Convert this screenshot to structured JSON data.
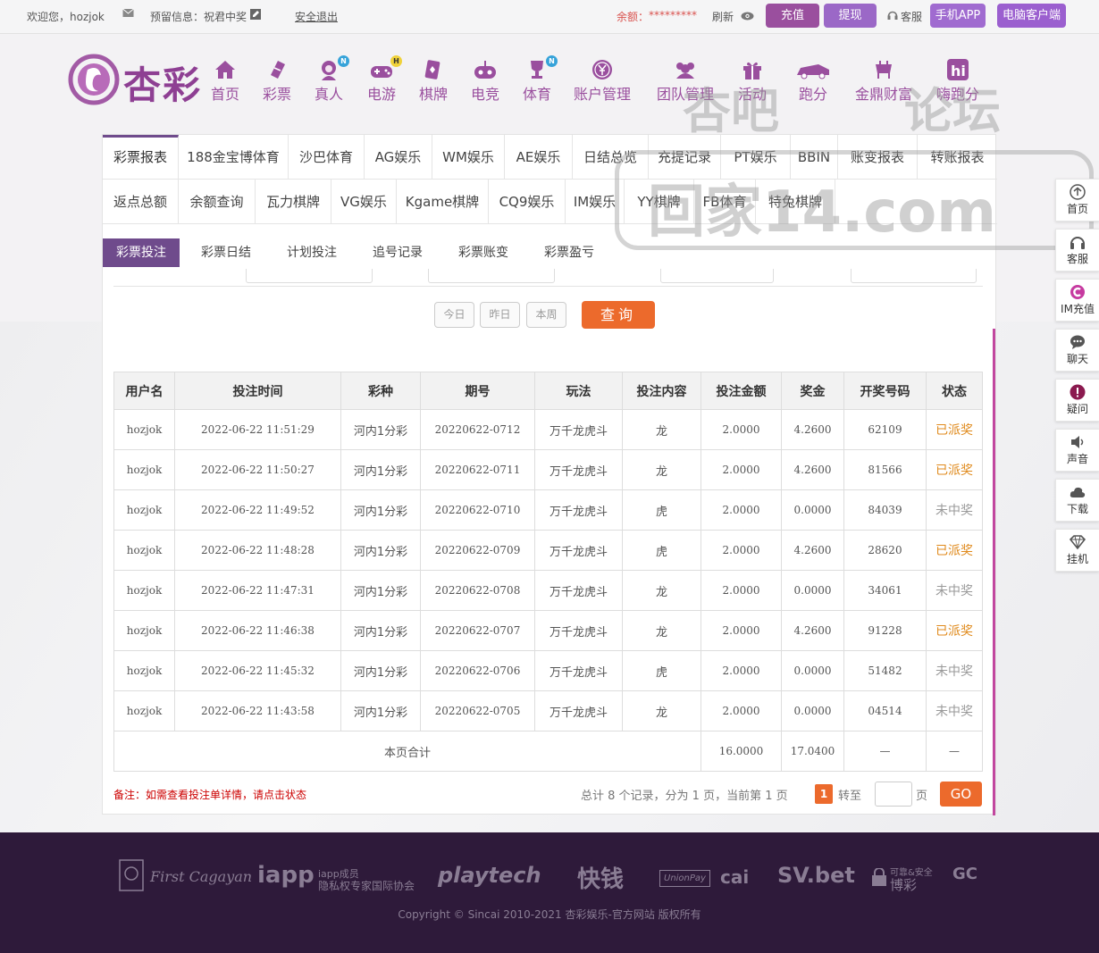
{
  "topbar": {
    "welcome": "欢迎您，hozjok",
    "reserved_info": "预留信息：祝君中奖",
    "logout": "安全退出",
    "balance_label": "余额：",
    "balance_value": "*********",
    "refresh": "刷新",
    "charge": "充值",
    "withdraw": "提现",
    "service": "客服",
    "mobile_app": "手机APP",
    "pc_client": "电脑客户端"
  },
  "logo_text": "杏彩",
  "nav": [
    {
      "label": "首页"
    },
    {
      "label": "彩票"
    },
    {
      "label": "真人",
      "badge": "N"
    },
    {
      "label": "电游",
      "badge": "H"
    },
    {
      "label": "棋牌"
    },
    {
      "label": "电竞"
    },
    {
      "label": "体育",
      "badge": "N"
    },
    {
      "label": "账户管理"
    },
    {
      "label": "团队管理"
    },
    {
      "label": "活动"
    },
    {
      "label": "跑分"
    },
    {
      "label": "金鼎财富"
    },
    {
      "label": "嗨跑分"
    }
  ],
  "watermark": {
    "line1a": "杏吧",
    "line1b": "论坛",
    "line2": "回家14.com"
  },
  "report_tabs_row1": [
    "彩票报表",
    "188金宝博体育",
    "沙巴体育",
    "AG娱乐",
    "WM娱乐",
    "AE娱乐",
    "日结总览",
    "充提记录",
    "PT娱乐",
    "BBIN",
    "账变报表",
    "转账报表"
  ],
  "report_tabs_row2": [
    "返点总额",
    "余额查询",
    "瓦力棋牌",
    "VG娱乐",
    "Kgame棋牌",
    "CQ9娱乐",
    "IM娱乐",
    "YY棋牌",
    "FB体育",
    "特兔棋牌"
  ],
  "sub_tabs": [
    "彩票投注",
    "彩票日结",
    "计划投注",
    "追号记录",
    "彩票账变",
    "彩票盈亏"
  ],
  "quick": {
    "today": "今日",
    "yesterday": "昨日",
    "week": "本周",
    "query": "查询"
  },
  "table": {
    "headers": [
      "用户名",
      "投注时间",
      "彩种",
      "期号",
      "玩法",
      "投注内容",
      "投注金额",
      "奖金",
      "开奖号码",
      "状态"
    ],
    "rows": [
      [
        "hozjok",
        "2022-06-22 11:51:29",
        "河内1分彩",
        "20220622-0712",
        "万千龙虎斗",
        "龙",
        "2.0000",
        "4.2600",
        "62109",
        "已派奖"
      ],
      [
        "hozjok",
        "2022-06-22 11:50:27",
        "河内1分彩",
        "20220622-0711",
        "万千龙虎斗",
        "龙",
        "2.0000",
        "4.2600",
        "81566",
        "已派奖"
      ],
      [
        "hozjok",
        "2022-06-22 11:49:52",
        "河内1分彩",
        "20220622-0710",
        "万千龙虎斗",
        "虎",
        "2.0000",
        "0.0000",
        "84039",
        "未中奖"
      ],
      [
        "hozjok",
        "2022-06-22 11:48:28",
        "河内1分彩",
        "20220622-0709",
        "万千龙虎斗",
        "虎",
        "2.0000",
        "4.2600",
        "28620",
        "已派奖"
      ],
      [
        "hozjok",
        "2022-06-22 11:47:31",
        "河内1分彩",
        "20220622-0708",
        "万千龙虎斗",
        "龙",
        "2.0000",
        "0.0000",
        "34061",
        "未中奖"
      ],
      [
        "hozjok",
        "2022-06-22 11:46:38",
        "河内1分彩",
        "20220622-0707",
        "万千龙虎斗",
        "龙",
        "2.0000",
        "4.2600",
        "91228",
        "已派奖"
      ],
      [
        "hozjok",
        "2022-06-22 11:45:32",
        "河内1分彩",
        "20220622-0706",
        "万千龙虎斗",
        "虎",
        "2.0000",
        "0.0000",
        "51482",
        "未中奖"
      ],
      [
        "hozjok",
        "2022-06-22 11:43:58",
        "河内1分彩",
        "20220622-0705",
        "万千龙虎斗",
        "龙",
        "2.0000",
        "0.0000",
        "04514",
        "未中奖"
      ]
    ],
    "total_label": "本页合计",
    "total_amount": "16.0000",
    "total_prize": "17.0400",
    "total_dash1": "—",
    "total_dash2": "—"
  },
  "note": "备注：如需查看投注单详情，请点击状态",
  "pager": {
    "summary": "总计 8 个记录，分为 1 页，当前第 1 页",
    "current": "1",
    "goto": "转至",
    "page_unit": "页",
    "go": "GO"
  },
  "float_bar": [
    "首页",
    "客服",
    "IM充值",
    "聊天",
    "疑问",
    "声音",
    "下载",
    "挂机"
  ],
  "footer": {
    "logos": [
      "First Cagayan",
      "iapp",
      "iapp成员",
      "隐私权专家国际协会",
      "playtech",
      "快钱",
      "UnionPay",
      "cai",
      "SV.bet",
      "可靠&安全",
      "博彩",
      "GC"
    ],
    "copyright": "Copyright © Sincai 2010-2021 杏彩娱乐-官方网站 版权所有"
  },
  "colors": {
    "brand": "#9a4f9e",
    "accent": "#ec6a2c",
    "won": "#e08a1c",
    "footer_bg": "#2e1a3a"
  }
}
